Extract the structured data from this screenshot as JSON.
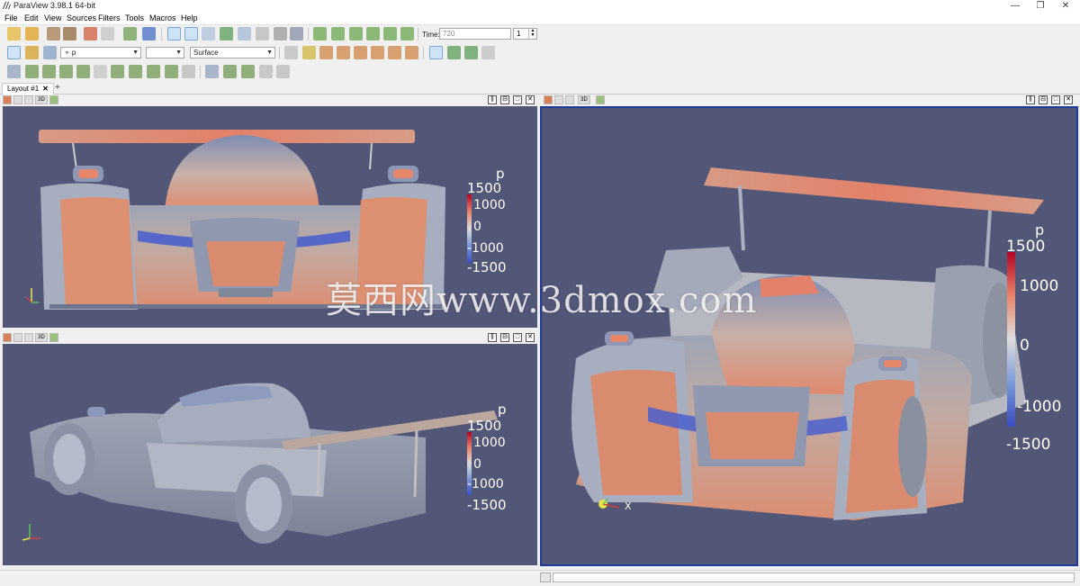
{
  "window": {
    "title": "ParaView 3.98.1 64-bit",
    "controls": [
      "—",
      "❐",
      "✕"
    ]
  },
  "menu": [
    "File",
    "Edit",
    "View",
    "Sources",
    "Filters",
    "Tools",
    "Macros",
    "Help"
  ],
  "time_toolbar": {
    "time_label": "Time:",
    "time_value": "720",
    "step_value": "1"
  },
  "representation_toolbar": {
    "variable": "⚬ p",
    "component": "",
    "representation": "Surface"
  },
  "tabs": [
    {
      "label": "Layout #1"
    }
  ],
  "tab_add": "+",
  "view_header": {
    "mode_3d": "3D"
  },
  "colorbar": {
    "title": "p",
    "labels": [
      "1500",
      "1000",
      "0",
      "-1000",
      "-1500"
    ]
  },
  "axes": {
    "x": "X"
  },
  "watermark": "莫西网www.3dmox.com",
  "colors": {
    "background": "#525677",
    "colormap_high": "#b40426",
    "colormap_mid": "#dddddd",
    "colormap_low": "#3b4cc0",
    "active_view_border": "#1e3c96"
  }
}
